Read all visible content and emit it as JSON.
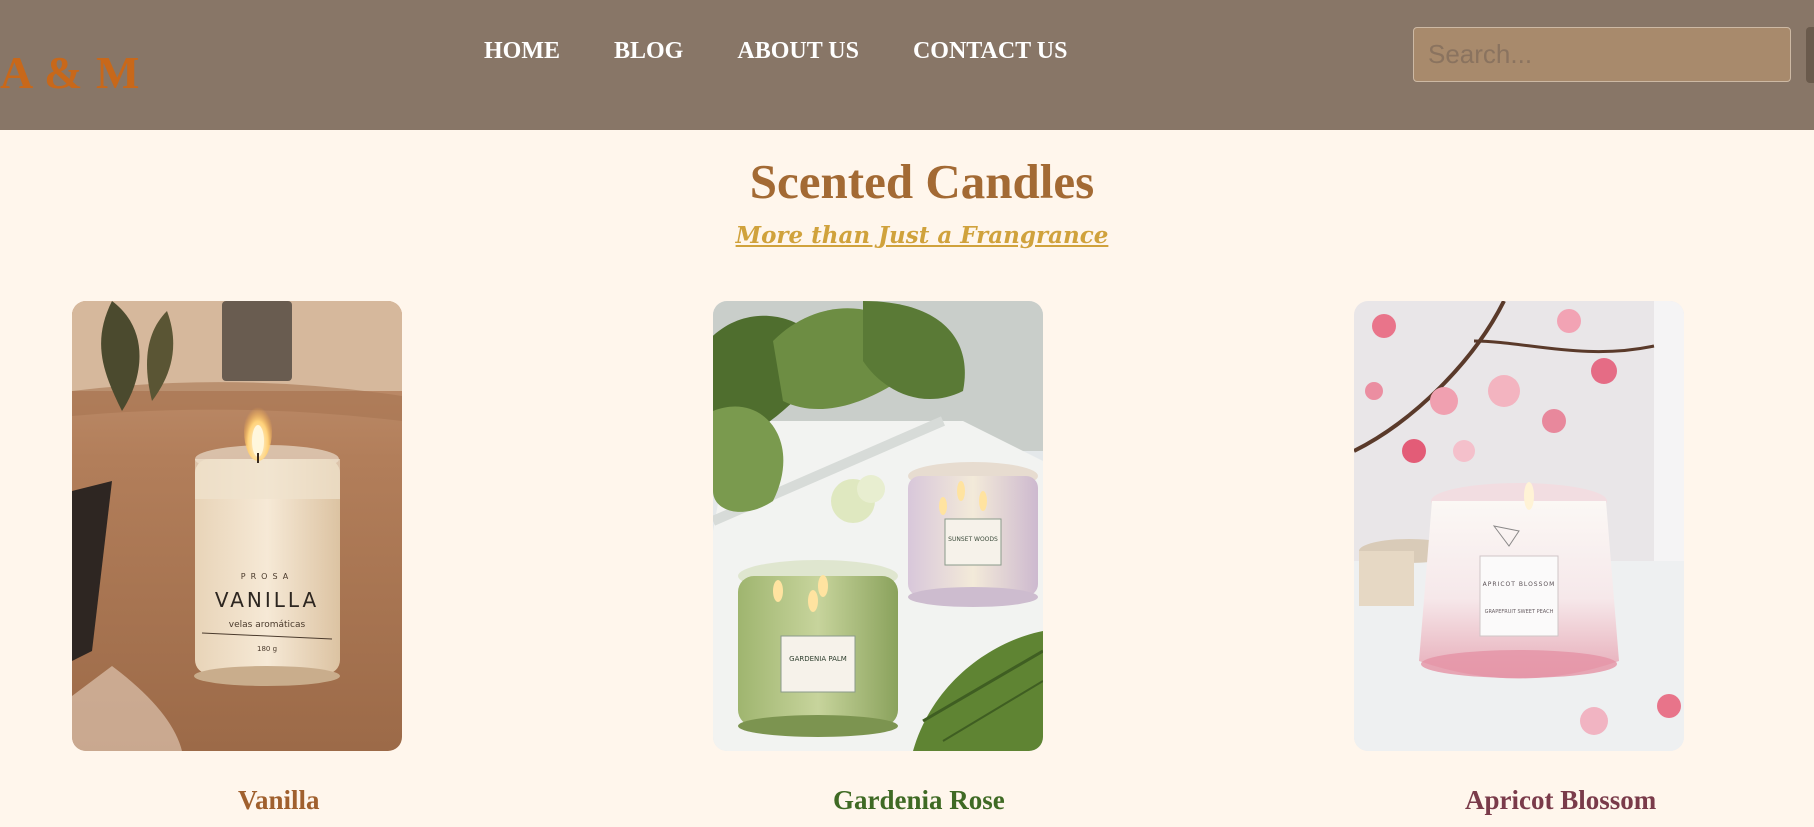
{
  "header": {
    "logo": "A & M",
    "nav": [
      "HOME",
      "BLOG",
      "ABOUT US",
      "CONTACT US"
    ],
    "search_placeholder": "Search..."
  },
  "hero": {
    "title": "Scented Candles",
    "subtitle": "More than Just a Frangrance"
  },
  "products": [
    {
      "name": "Vanilla",
      "color": "#a0602e",
      "jar_label": "VANILLA",
      "jar_brand": "PROSA",
      "jar_sub": "velas aromáticas",
      "jar_weight": "180 g"
    },
    {
      "name": "Gardenia Rose",
      "color": "#3f6a24",
      "jar_label": "GARDENIA PALM",
      "jar_label2": "SUNSET WOODS"
    },
    {
      "name": "Apricot Blossom",
      "color": "#7a3b4a",
      "jar_label": "APRICOT BLOSSOM",
      "jar_sub": "GRAPEFRUIT SWEET PEACH"
    }
  ],
  "colors": {
    "nav_bg": "#887667",
    "page_bg": "#fff6ec",
    "title": "#a36a34",
    "subtitle": "#d0a23c",
    "logo": "#c8681a"
  }
}
